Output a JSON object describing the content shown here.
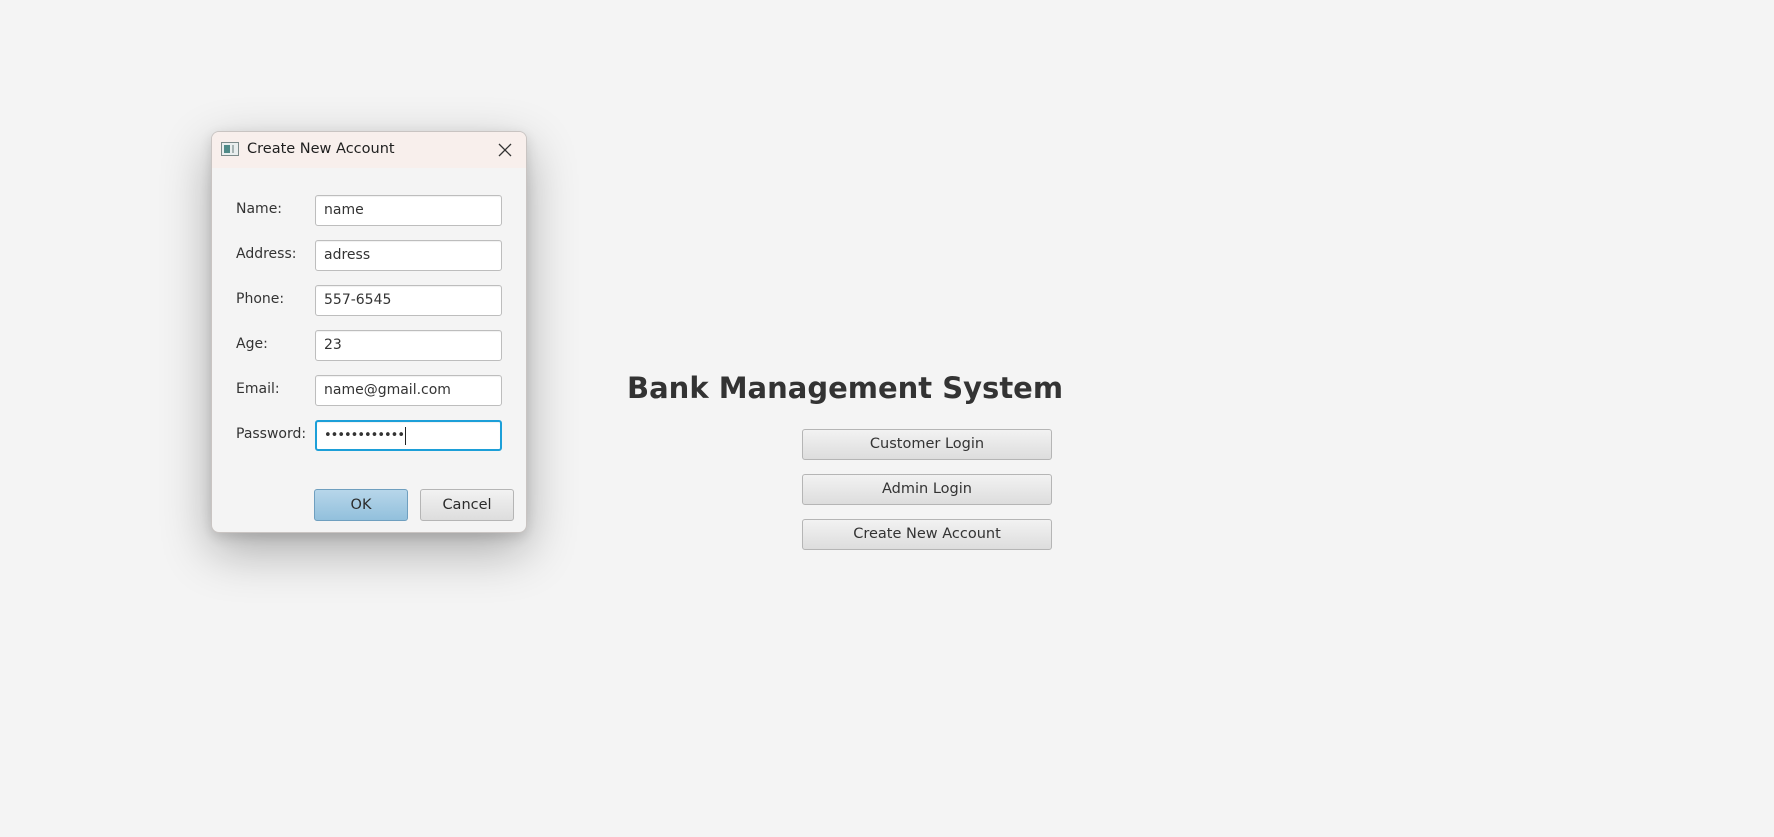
{
  "main": {
    "title": "Bank Management System",
    "buttons": {
      "customer_login": "Customer Login",
      "admin_login": "Admin Login",
      "create_account": "Create New Account"
    }
  },
  "dialog": {
    "title": "Create New Account",
    "fields": {
      "name": {
        "label": "Name:",
        "value": "name"
      },
      "address": {
        "label": "Address:",
        "value": "adress"
      },
      "phone": {
        "label": "Phone:",
        "value": "557-6545"
      },
      "age": {
        "label": "Age:",
        "value": "23"
      },
      "email": {
        "label": "Email:",
        "value": "name@gmail.com"
      },
      "password": {
        "label": "Password:",
        "value": "••••••••••••"
      }
    },
    "ok_label": "OK",
    "cancel_label": "Cancel"
  },
  "colors": {
    "background": "#f4f4f4",
    "titlebar": "#f8efec",
    "focus_border": "#1c9fd8",
    "default_button": "#a6cde4"
  },
  "icons": {
    "app": "app-window-icon",
    "close": "close-icon"
  }
}
